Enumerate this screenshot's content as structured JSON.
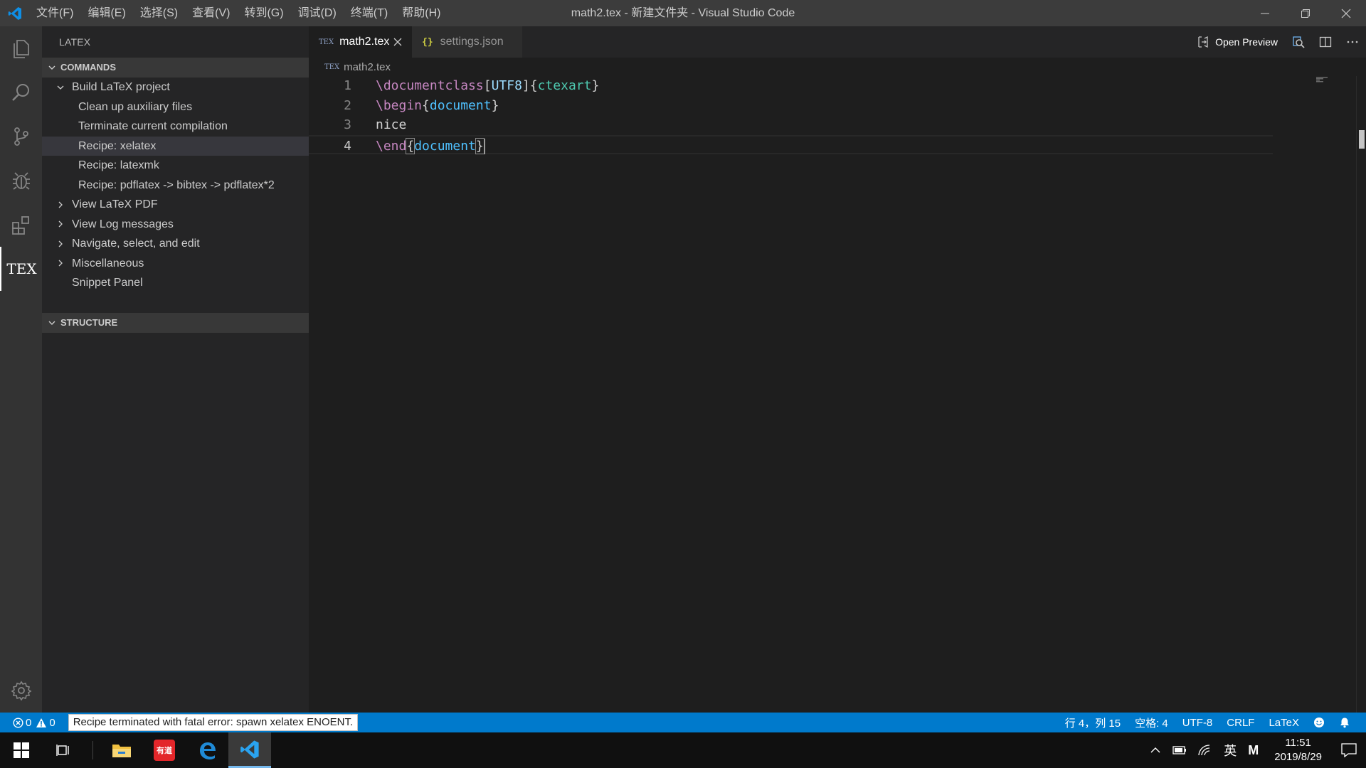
{
  "titlebar": {
    "menus": [
      "文件(F)",
      "编辑(E)",
      "选择(S)",
      "查看(V)",
      "转到(G)",
      "调试(D)",
      "终端(T)",
      "帮助(H)"
    ],
    "window_title": "math2.tex - 新建文件夹 - Visual Studio Code"
  },
  "activitybar": {
    "tex_label": "TEX"
  },
  "sidebar": {
    "title": "LATEX",
    "commands_header": "COMMANDS",
    "structure_header": "STRUCTURE",
    "items": [
      {
        "label": "Build LaTeX project",
        "level": 0,
        "twisty": "open"
      },
      {
        "label": "Clean up auxiliary files",
        "level": 1,
        "twisty": "none"
      },
      {
        "label": "Terminate current compilation",
        "level": 1,
        "twisty": "none"
      },
      {
        "label": "Recipe: xelatex",
        "level": 1,
        "twisty": "none",
        "selected": true
      },
      {
        "label": "Recipe: latexmk",
        "level": 1,
        "twisty": "none"
      },
      {
        "label": "Recipe: pdflatex -> bibtex -> pdflatex*2",
        "level": 1,
        "twisty": "none"
      },
      {
        "label": "View LaTeX PDF",
        "level": 0,
        "twisty": "closed"
      },
      {
        "label": "View Log messages",
        "level": 0,
        "twisty": "closed"
      },
      {
        "label": "Navigate, select, and edit",
        "level": 0,
        "twisty": "closed"
      },
      {
        "label": "Miscellaneous",
        "level": 0,
        "twisty": "closed"
      },
      {
        "label": "Snippet Panel",
        "level": 0,
        "twisty": "none"
      }
    ]
  },
  "editor": {
    "tabs": [
      {
        "label": "math2.tex",
        "icon": "TEX",
        "active": true
      },
      {
        "label": "settings.json",
        "icon": "{}",
        "active": false
      }
    ],
    "open_preview_label": "Open Preview",
    "breadcrumb_icon": "TEX",
    "breadcrumb": "math2.tex",
    "line_numbers": [
      "1",
      "2",
      "3",
      "4"
    ],
    "lines": {
      "l1": {
        "cmd": "\\documentclass",
        "open_opt": "[",
        "opt": "UTF8",
        "close_opt": "]",
        "open": "{",
        "arg": "ctexart",
        "close": "}"
      },
      "l2": {
        "cmd": "\\begin",
        "open": "{",
        "arg": "document",
        "close": "}"
      },
      "l3": {
        "text": "nice"
      },
      "l4": {
        "cmd": "\\end",
        "open": "{",
        "arg": "document",
        "close": "}"
      }
    },
    "current_line": 4
  },
  "statusbar": {
    "errors": "0",
    "warnings": "0",
    "message": "Recipe terminated with fatal error: spawn xelatex ENOENT.",
    "position": "行 4，列 15",
    "spaces": "空格: 4",
    "encoding": "UTF-8",
    "eol": "CRLF",
    "language": "LaTeX"
  },
  "taskbar": {
    "ime": "英",
    "ime2": "M",
    "time": "11:51",
    "date": "2019/8/29",
    "app_label": "有道"
  },
  "colors": {
    "accent": "#007acc",
    "titlebar": "#3c3c3c",
    "activitybar": "#333333",
    "sidebar": "#252526",
    "editor": "#1e1e1e"
  }
}
